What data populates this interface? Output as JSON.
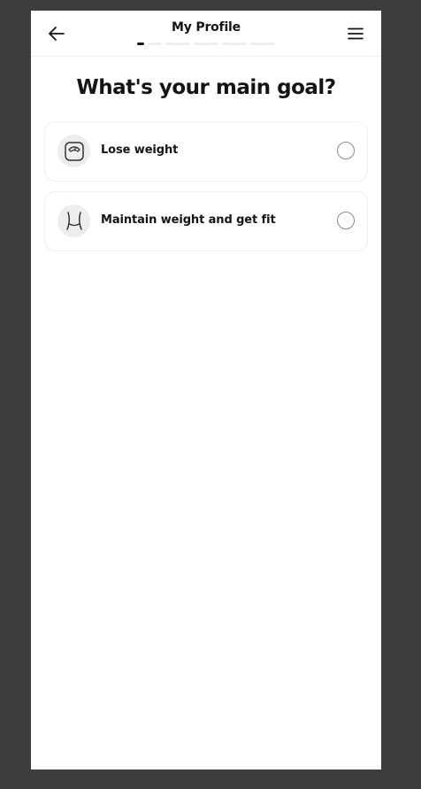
{
  "header": {
    "title": "My Profile",
    "progress": {
      "current_step": 1,
      "total_steps": 5
    }
  },
  "question": "What's your main goal?",
  "options": [
    {
      "label": "Lose weight",
      "icon": "scale-icon",
      "selected": false
    },
    {
      "label": "Maintain weight and get fit",
      "icon": "waist-icon",
      "selected": false
    }
  ]
}
